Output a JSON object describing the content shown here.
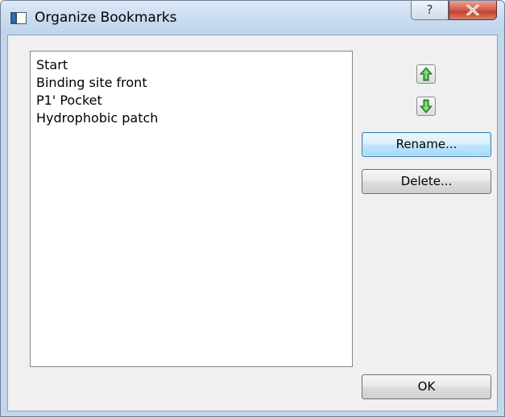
{
  "window": {
    "title": "Organize Bookmarks",
    "help_label": "?"
  },
  "bookmarks": {
    "items": [
      "Start",
      "Binding site front",
      "P1' Pocket",
      "Hydrophobic patch"
    ]
  },
  "buttons": {
    "rename": "Rename...",
    "delete": "Delete...",
    "ok": "OK"
  },
  "icons": {
    "window": "dialog-window-icon",
    "move_up": "green-up-arrow-icon",
    "move_down": "green-down-arrow-icon",
    "close": "close-x-icon"
  },
  "colors": {
    "arrow_green": "#3aa83a",
    "close_red": "#c4422f",
    "focus_blue": "#3c7fb1"
  }
}
